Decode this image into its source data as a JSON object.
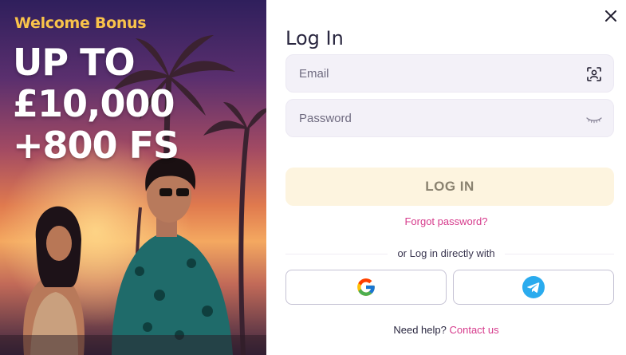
{
  "promo": {
    "welcome": "Welcome Bonus",
    "headline_lines": [
      "UP TO",
      "£10,000",
      "+800 FS"
    ],
    "accent_color": "#f9c34a"
  },
  "login": {
    "title": "Log In",
    "email_placeholder": "Email",
    "password_placeholder": "Password",
    "submit_label": "LOG IN",
    "forgot_label": "Forgot password?",
    "divider_label": "or Log in directly with",
    "help_text": "Need help?",
    "contact_label": "Contact us",
    "link_color": "#d63b8c"
  },
  "icons": {
    "close": "close-icon",
    "email_field": "face-scan-icon",
    "password_field": "eye-closed-icon",
    "google": "google-icon",
    "telegram": "telegram-icon"
  }
}
